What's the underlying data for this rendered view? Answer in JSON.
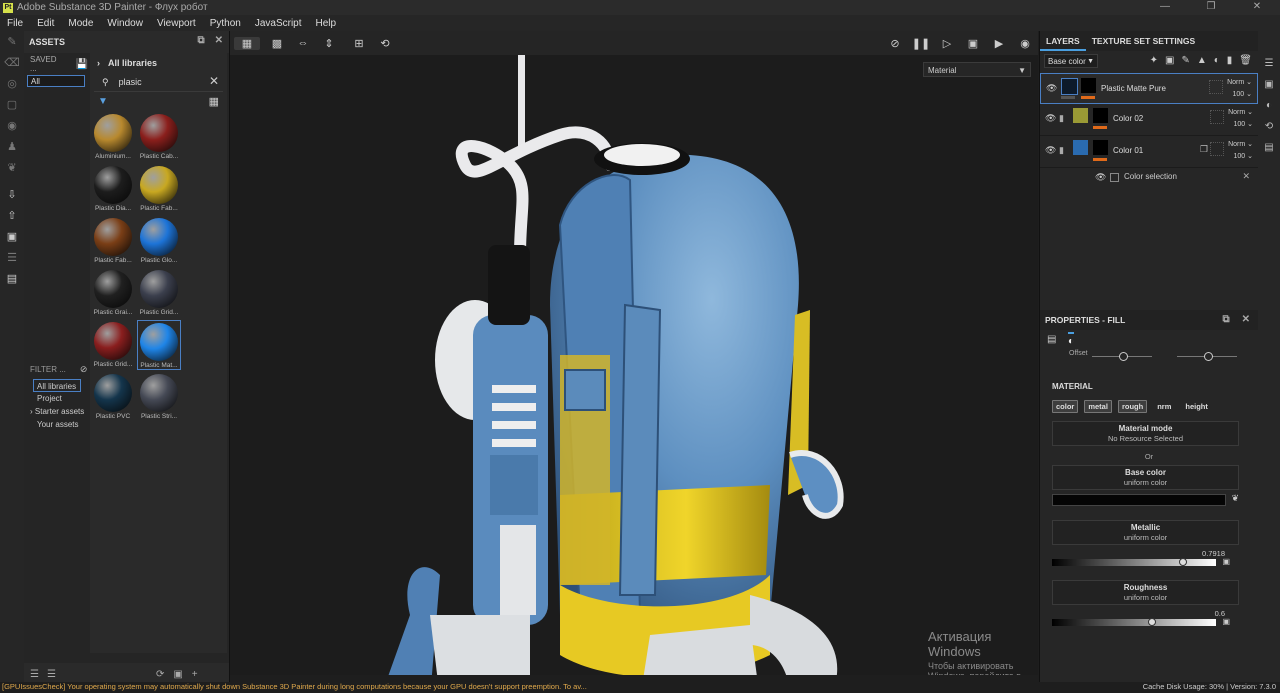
{
  "window": {
    "title": "Adobe Substance 3D Painter - Флух робот",
    "app_icon": "Pt"
  },
  "menu": [
    "File",
    "Edit",
    "Mode",
    "Window",
    "Viewport",
    "Python",
    "JavaScript",
    "Help"
  ],
  "assets": {
    "header": "ASSETS",
    "saved_label": "SAVED ...",
    "saved_value": "All",
    "library_title": "All libraries",
    "search_value": "plasic",
    "filter_label": "FILTER ...",
    "filter_items": [
      "All libraries",
      "Project",
      "Starter assets",
      "Your assets"
    ],
    "materials": [
      {
        "label": "Aluminium...",
        "color": "#b8892e"
      },
      {
        "label": "Plastic Cab...",
        "color": "#8b1f1c"
      },
      {
        "label": "Plastic Dia...",
        "color": "#1d1d1d"
      },
      {
        "label": "Plastic Fab...",
        "color": "#c8a821"
      },
      {
        "label": "Plastic Fab...",
        "color": "#7a3e16"
      },
      {
        "label": "Plastic Glo...",
        "color": "#1d74d8"
      },
      {
        "label": "Plastic Grai...",
        "color": "#202020"
      },
      {
        "label": "Plastic Grid...",
        "color": "#3b3f4d"
      },
      {
        "label": "Plastic Grid...",
        "color": "#8a1e1e"
      },
      {
        "label": "Plastic Mat...",
        "color": "#1f85e8"
      },
      {
        "label": "Plastic PVC",
        "color": "#14354c"
      },
      {
        "label": "Plastic Stri...",
        "color": "#454955"
      }
    ]
  },
  "viewport": {
    "material_select": "Material",
    "activation_line1": "Активация Windows",
    "activation_line2": "Чтобы активировать Windows, перейдите в раздел \"Параметры\"."
  },
  "layers": {
    "tabs": [
      "LAYERS",
      "TEXTURE SET SETTINGS"
    ],
    "channel": "Base color",
    "rows": [
      {
        "name": "Plastic Matte Pure",
        "blend": "Norm",
        "opacity": "100",
        "thumb_color": "#0d1a2a",
        "selected": true
      },
      {
        "name": "Color 02",
        "blend": "Norm",
        "opacity": "100",
        "thumb_color": "#9a9a35",
        "selected": false
      },
      {
        "name": "Color 01",
        "blend": "Norm",
        "opacity": "100",
        "thumb_color": "#2a6bb0",
        "selected": false
      }
    ],
    "sub_row": "Color selection"
  },
  "properties": {
    "header": "PROPERTIES - FILL",
    "offset_label": "Offset",
    "section": "MATERIAL",
    "channels": [
      "color",
      "metal",
      "rough",
      "nrm",
      "height"
    ],
    "material_mode_title": "Material mode",
    "material_mode_sub": "No Resource Selected",
    "or_label": "Or",
    "base_color_title": "Base color",
    "base_color_sub": "uniform color",
    "metallic_title": "Metallic",
    "metallic_sub": "uniform color",
    "metallic_value": "0.7918",
    "roughness_title": "Roughness",
    "roughness_sub": "uniform color",
    "roughness_value": "0.6"
  },
  "status": {
    "message": "[GPUIssuesCheck] Your operating system may automatically shut down Substance 3D Painter during long computations because your GPU doesn't support preemption. To av...",
    "cache": "Cache Disk Usage:   30% | Version: 7.3.0"
  }
}
